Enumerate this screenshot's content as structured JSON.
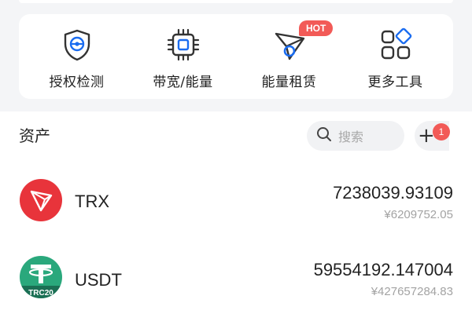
{
  "tools": [
    {
      "label": "授权检测",
      "icon": "shield-check-icon"
    },
    {
      "label": "带宽/能量",
      "icon": "chip-icon"
    },
    {
      "label": "能量租赁",
      "icon": "paper-plane-icon",
      "badge": "HOT"
    },
    {
      "label": "更多工具",
      "icon": "grid-icon"
    }
  ],
  "assets_section": {
    "title": "资产",
    "search_placeholder": "搜索",
    "add_label": "+",
    "notification_count": "1"
  },
  "assets": [
    {
      "symbol": "TRX",
      "amount": "7238039.93109",
      "fiat": "¥6209752.05",
      "icon": "trx-logo-icon",
      "color": "#e8343b"
    },
    {
      "symbol": "USDT",
      "amount": "59554192.147004",
      "fiat": "¥427657284.83",
      "icon": "usdt-trc20-logo-icon",
      "color": "#2aa87c",
      "tag": "TRC20"
    }
  ],
  "colors": {
    "accent": "#1a6cf0",
    "hot": "#f25a57",
    "trx": "#e8343b",
    "usdt": "#2aa87c"
  }
}
